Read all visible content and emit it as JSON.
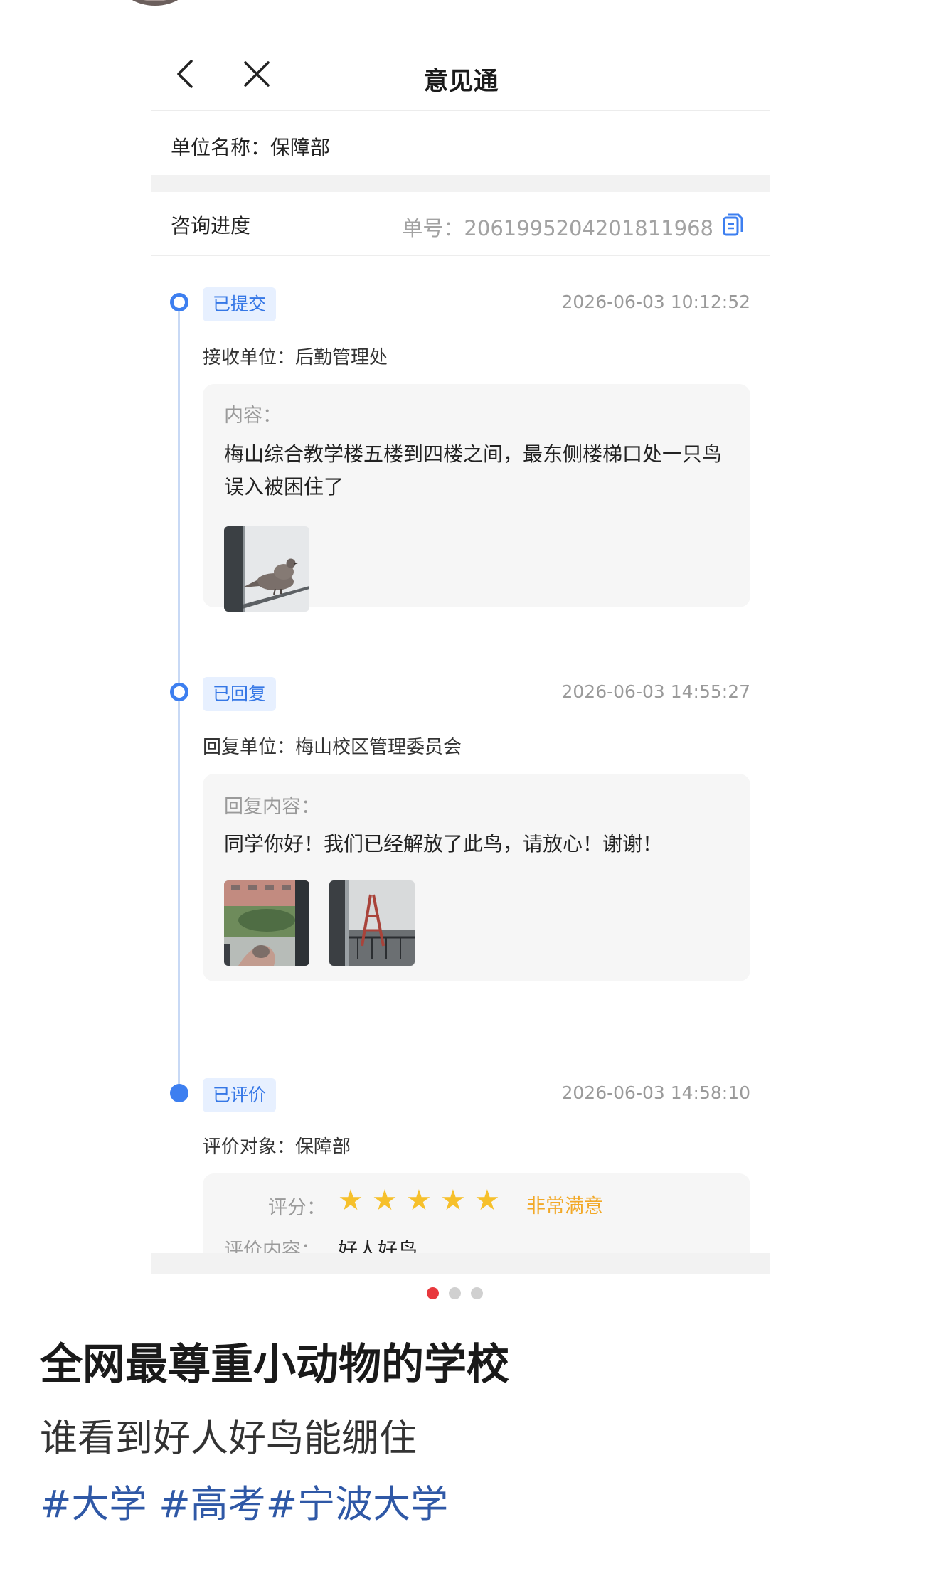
{
  "nav": {
    "title": "意见通"
  },
  "unit": {
    "text": "单位名称：保障部"
  },
  "progress": {
    "label": "咨询进度",
    "order": "单号：2061995204201811968"
  },
  "timeline": [
    {
      "badge": "已提交",
      "time": "2026-06-03 10:12:52",
      "meta": "接收单位：后勤管理处",
      "box_label": "内容：",
      "content": "梅山综合教学楼五楼到四楼之间，最东侧楼梯口处一只鸟误入被困住了"
    },
    {
      "badge": "已回复",
      "time": "2026-06-03 14:55:27",
      "meta": "回复单位：梅山校区管理委员会",
      "box_label": "回复内容：",
      "content": "同学你好！我们已经解放了此鸟，请放心！谢谢！"
    },
    {
      "badge": "已评价",
      "time": "2026-06-03 14:58:10",
      "meta": "评价对象：保障部",
      "score_label": "评分：",
      "stars": 5,
      "score_text": "非常满意",
      "eval_label": "评价内容：",
      "eval_value": "好人好鸟"
    }
  ],
  "icons": {
    "back": "chevron-left-icon",
    "close": "close-icon",
    "copy": "copy-icon",
    "star": "star-icon"
  },
  "colors": {
    "accent": "#3d7ff0",
    "star": "#f6c02b",
    "rating_text": "#f2a826",
    "pager_active": "#e8383d",
    "hashtag": "#2f58a6"
  },
  "pager": {
    "count": 3,
    "active": 0
  },
  "post": {
    "title": "全网最尊重小动物的学校",
    "body": "谁看到好人好鸟能绷住",
    "tags": [
      "#大学 ",
      "#高考",
      "#宁波大学"
    ]
  }
}
